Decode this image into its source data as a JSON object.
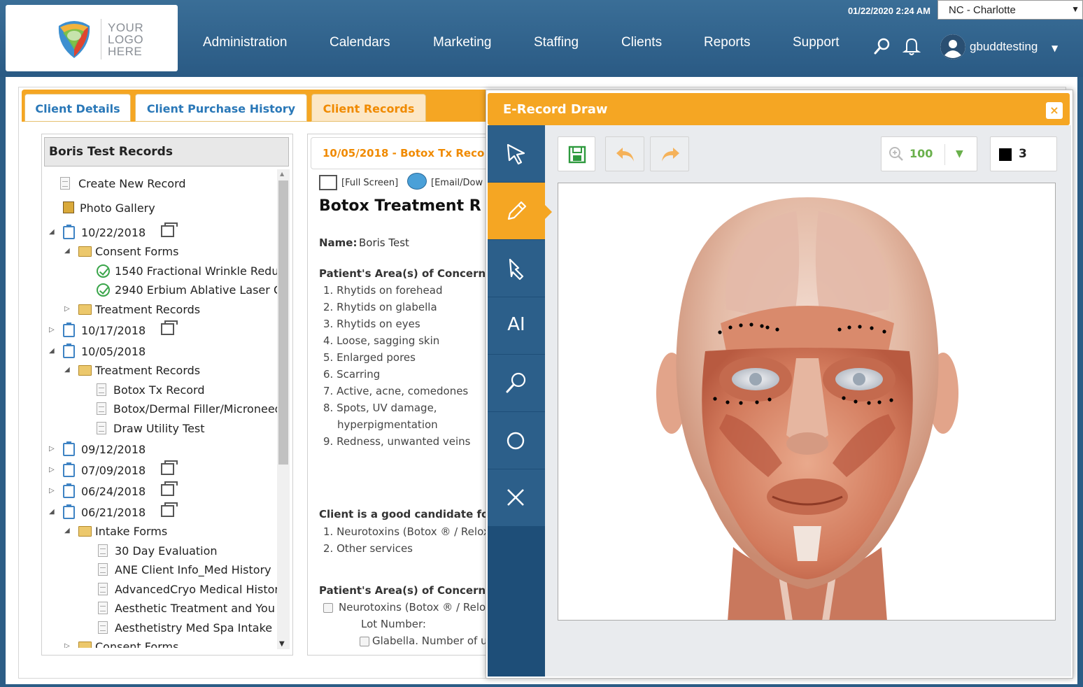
{
  "header": {
    "logo_lines": [
      "YOUR",
      "LOGO",
      "HERE"
    ],
    "datetime": "01/22/2020 2:24 AM",
    "location": "NC - Charlotte",
    "nav": [
      "Administration",
      "Calendars",
      "Marketing",
      "Staffing",
      "Clients",
      "Reports",
      "Support"
    ],
    "username": "gbuddtesting"
  },
  "tabs": [
    "Client Details",
    "Client Purchase History",
    "Client Records"
  ],
  "active_tab": "Client Records",
  "tree": {
    "title": "Boris Test Records",
    "create_new": "Create New Record",
    "photo_gallery": "Photo Gallery",
    "nodes": [
      "10/22/2018",
      "Consent Forms",
      "1540 Fractional Wrinkle Redu",
      "2940 Erbium Ablative Laser C",
      "Treatment Records",
      "10/17/2018",
      "10/05/2018",
      "Treatment Records",
      "Botox Tx Record",
      "Botox/Dermal Filler/Microneed",
      "Draw Utility Test",
      "09/12/2018",
      "07/09/2018",
      "06/24/2018",
      "06/21/2018",
      "Intake Forms",
      "30 Day Evaluation",
      "ANE Client Info_Med History",
      "AdvancedCryo Medical Histor",
      "Aesthetic Treatment and You",
      "Aesthetistry Med Spa Intake",
      "Consent Forms"
    ]
  },
  "record": {
    "header": "10/05/2018 - Botox Tx Reco",
    "full_screen": "[Full Screen]",
    "email": "[Email/Dow",
    "title": "Botox Treatment R",
    "name_label": "Name:",
    "name_value": "Boris Test",
    "concern_heading": "Patient's Area(s) of Concern",
    "concerns": [
      "1. Rhytids on forehead",
      "2. Rhytids on glabella",
      "3. Rhytids on eyes",
      "4. Loose, sagging skin",
      "5. Enlarged pores",
      "6. Scarring",
      "7. Active, acne, comedones",
      "8. Spots, UV damage,",
      "hyperpigmentation",
      "9. Redness, unwanted veins"
    ],
    "candidate_heading": "Client is a good candidate for:",
    "candidates": [
      "1. Neurotoxins (Botox ® / Relox",
      "2. Other services"
    ],
    "concern_heading2": "Patient's Area(s) of Concern",
    "check1": "Neurotoxins (Botox ® / Relox",
    "lot_number": "Lot Number:",
    "check2": "Glabella. Number of un"
  },
  "dialog": {
    "title": "E-Record Draw",
    "close": "×",
    "tools": [
      "select-arrow",
      "pencil",
      "pointer",
      "AI",
      "magnifier",
      "circle",
      "close"
    ],
    "ai_label": "AI",
    "zoom": "100",
    "stroke_width": "3",
    "stroke_color": "#000000"
  },
  "colors": {
    "accent": "#f5a623",
    "nav_bg": "#2c5d86",
    "link": "#2a78b8",
    "rail": "#1e4e78"
  }
}
